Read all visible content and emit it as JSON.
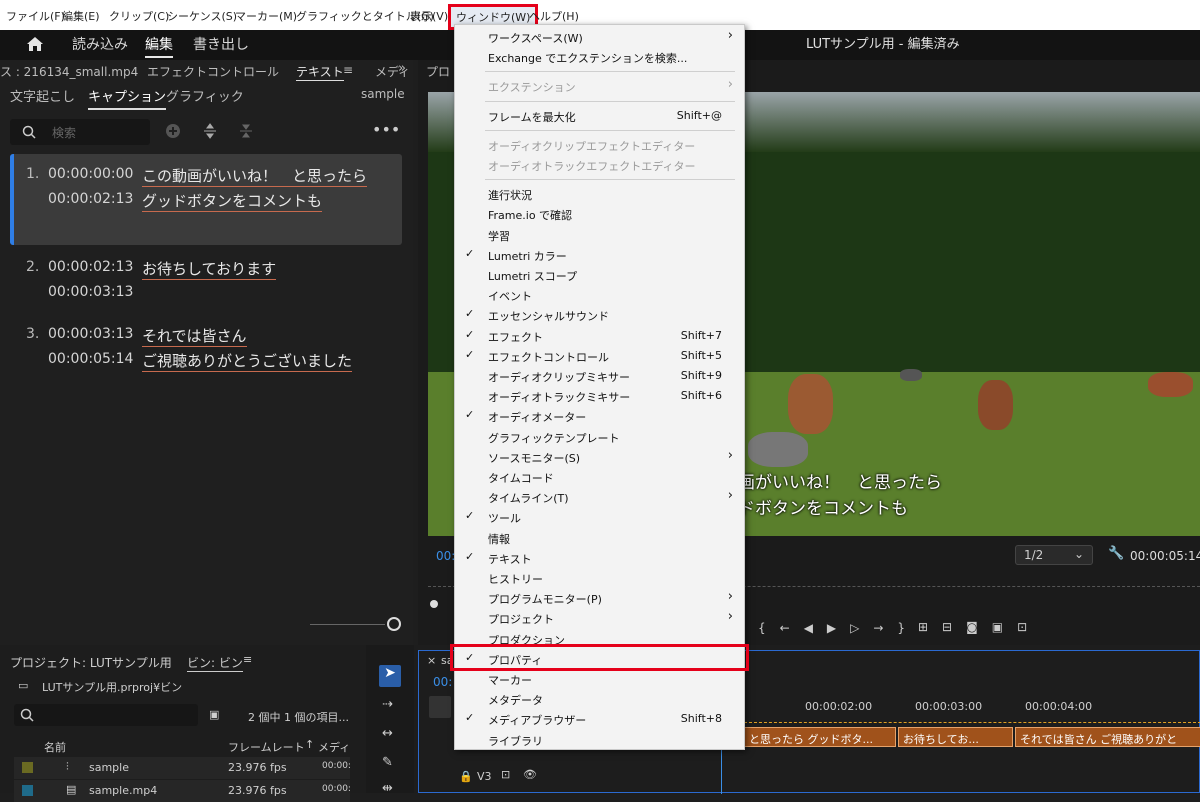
{
  "menubar": {
    "items": [
      "ファイル(F)",
      "編集(E)",
      "クリップ(C)",
      "シーケンス(S)",
      "マーカー(M)",
      "グラフィックとタイトル(G)",
      "表示(V)",
      "ウィンドウ(W)",
      "ヘルプ(H)"
    ]
  },
  "appbar": {
    "nav": [
      "読み込み",
      "編集",
      "書き出し"
    ],
    "title": "LUTサンプル用 - 編集済み"
  },
  "left": {
    "source": "ス : 216134_small.mp4",
    "tabs": [
      "エフェクトコントロール",
      "テキスト",
      "メディ"
    ],
    "subtabs": [
      "文字起こし",
      "キャプション",
      "グラフィック"
    ],
    "track": "sample",
    "search_placeholder": "検索",
    "captions": [
      {
        "n": "1.",
        "start": "00:00:00:00",
        "end": "00:00:02:13",
        "l1": "この動画がいいね！　と思ったら",
        "l2": "グッドボタンをコメントも"
      },
      {
        "n": "2.",
        "start": "00:00:02:13",
        "end": "00:00:03:13",
        "l1": "お待ちしております",
        "l2": ""
      },
      {
        "n": "3.",
        "start": "00:00:03:13",
        "end": "00:00:05:14",
        "l1": "それでは皆さん",
        "l2": "ご視聴ありがとうございました"
      }
    ]
  },
  "preview": {
    "tab": "プロ",
    "subtitle1": "画がいいね！　と思ったら",
    "subtitle2": "ドボタンをコメントも",
    "current_time": "00:",
    "zoom": "1/2",
    "duration": "00:00:05:14"
  },
  "project": {
    "title": "プロジェクト: LUTサンプル用",
    "bin_tab": "ビン: ビン",
    "path": "LUTサンプル用.prproj¥ビン",
    "count": "2 個中 1 個の項目...",
    "col_name": "名前",
    "col_fps": "フレームレート",
    "col_media": "メディ",
    "rows": [
      {
        "name": "sample",
        "fps": "23.976 fps",
        "t": "00:00:"
      },
      {
        "name": "sample.mp4",
        "fps": "23.976 fps",
        "t": "00:00:"
      }
    ]
  },
  "timeline": {
    "tab": "sa",
    "time": "00:",
    "ruler": [
      "00:00:02:00",
      "00:00:03:00",
      "00:00:04:00"
    ],
    "clips": [
      "と思ったら グッドボタ...",
      "お待ちしてお...",
      "それでは皆さん ご視聴ありがと"
    ],
    "track": "V3"
  },
  "menu": {
    "items": [
      {
        "label": "ワークスペース(W)",
        "arrow": true
      },
      {
        "label": "Exchange でエクステンションを検索..."
      },
      {
        "sep": true
      },
      {
        "label": "エクステンション",
        "arrow": true,
        "disabled": true
      },
      {
        "sep": true
      },
      {
        "label": "フレームを最大化",
        "shortcut": "Shift+@"
      },
      {
        "sep": true
      },
      {
        "label": "オーディオクリップエフェクトエディター",
        "disabled": true
      },
      {
        "label": "オーディオトラックエフェクトエディター",
        "disabled": true
      },
      {
        "sep": true
      },
      {
        "label": "進行状況"
      },
      {
        "label": "Frame.io で確認"
      },
      {
        "label": "学習"
      },
      {
        "label": "Lumetri カラー",
        "check": true
      },
      {
        "label": "Lumetri スコープ"
      },
      {
        "label": "イベント"
      },
      {
        "label": "エッセンシャルサウンド",
        "check": true
      },
      {
        "label": "エフェクト",
        "shortcut": "Shift+7",
        "check": true
      },
      {
        "label": "エフェクトコントロール",
        "shortcut": "Shift+5",
        "check": true
      },
      {
        "label": "オーディオクリップミキサー",
        "shortcut": "Shift+9"
      },
      {
        "label": "オーディオトラックミキサー",
        "shortcut": "Shift+6"
      },
      {
        "label": "オーディオメーター",
        "check": true
      },
      {
        "label": "グラフィックテンプレート"
      },
      {
        "label": "ソースモニター(S)",
        "arrow": true
      },
      {
        "label": "タイムコード"
      },
      {
        "label": "タイムライン(T)",
        "arrow": true
      },
      {
        "label": "ツール",
        "check": true
      },
      {
        "label": "情報"
      },
      {
        "label": "テキスト",
        "check": true
      },
      {
        "label": "ヒストリー"
      },
      {
        "label": "プログラムモニター(P)",
        "arrow": true
      },
      {
        "label": "プロジェクト",
        "arrow": true
      },
      {
        "label": "プロダクション"
      },
      {
        "label": "プロパティ",
        "check": true
      },
      {
        "label": "マーカー"
      },
      {
        "label": "メタデータ"
      },
      {
        "label": "メディアブラウザー",
        "shortcut": "Shift+8",
        "check": true
      },
      {
        "label": "ライブラリ"
      }
    ]
  }
}
